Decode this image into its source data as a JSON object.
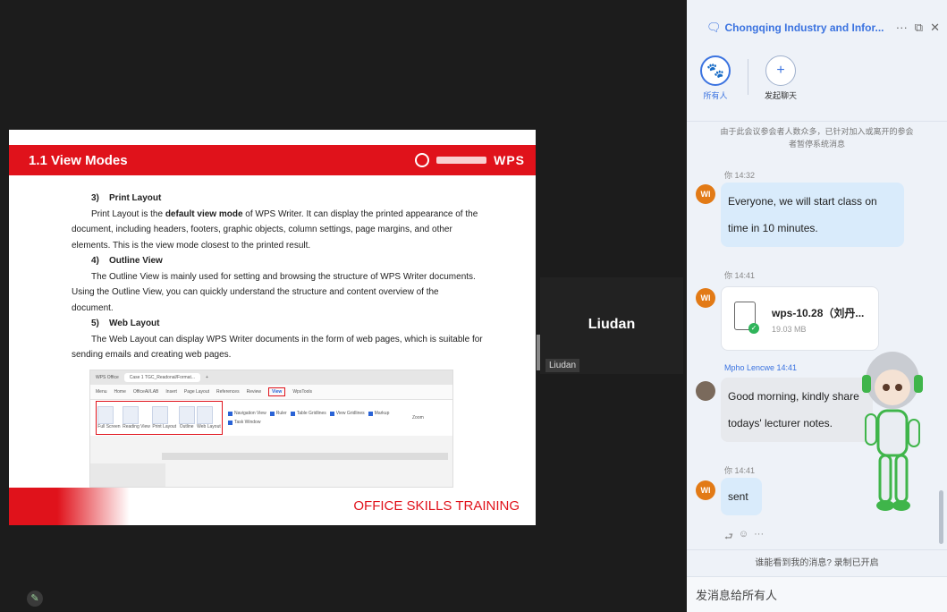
{
  "slide": {
    "title": "1.1 View Modes",
    "brand": "WPS",
    "footer": "OFFICE SKILLS TRAINING",
    "sections": [
      {
        "heading": "3)    Print Layout",
        "text_pre": "Print Layout is the ",
        "text_bold": "default view mode",
        "text_post": " of WPS Writer. It can display the printed appearance of the document, including headers, footers, graphic objects, column settings, page margins, and other elements. This is the view mode closest to the printed result."
      },
      {
        "heading": "4)    Outline View",
        "text": "The Outline View is mainly used for setting and browsing the structure of WPS Writer documents. Using the Outline View, you can quickly understand the structure and content overview of the document."
      },
      {
        "heading": "5)    Web Layout",
        "text": "The Web Layout can display WPS Writer documents in the form of web pages, which is suitable for sending emails and creating web pages."
      }
    ],
    "mini": {
      "app": "WPS Office",
      "doc_tab": "Case 1 TGC_Readonal/Format...",
      "menu": [
        "Menu",
        "Home",
        "OfficeAI/LAB",
        "Insert",
        "Page Layout",
        "References",
        "Review",
        "View",
        "WpsTools"
      ],
      "active_menu": "View",
      "buttons": [
        "Full Screen",
        "Reading View",
        "Print Layout",
        "Outline",
        "Web Layout"
      ],
      "checks": [
        "Navigation View",
        "Ruler",
        "Table Gridlines",
        "View Gridlines",
        "Markup",
        "Task Window"
      ],
      "zoom": "Zoom"
    }
  },
  "tile": {
    "name": "Liudan",
    "label": "Liudan"
  },
  "panel": {
    "group_name": "Chongqing Industry and Infor...",
    "convos": [
      {
        "label": "所有人",
        "active": true
      },
      {
        "label": "发起聊天",
        "active": false
      }
    ],
    "system_note": "由于此会议参会者人数众多，已针对加入或离开的参会者暂停系统消息",
    "messages": [
      {
        "avatar": "WI",
        "meta": "你 14:32",
        "text": "Everyone, we will start class on time in 10 minutes."
      },
      {
        "avatar": "WI",
        "meta": "你 14:41",
        "file_name": "wps-10.28（刘丹...",
        "file_size": "19.03 MB"
      },
      {
        "avatar": "",
        "meta": "Mpho Lencwe 14:41",
        "text": "Good morning, kindly share todays' lecturer notes."
      },
      {
        "avatar": "WI",
        "meta": "你 14:41",
        "text": "sent"
      }
    ],
    "read_note": "谁能看到我的消息? 录制已开启",
    "compose_placeholder": "发消息给所有人"
  },
  "colors": {
    "accent_red": "#e0121b",
    "accent_blue": "#3b73e0",
    "avatar_orange": "#e27a16"
  },
  "icons": [
    "chat-icon",
    "more-icon",
    "popout-icon",
    "close-icon",
    "paw-icon",
    "plus-icon",
    "file-icon",
    "check-icon",
    "reply-icon",
    "emoji-icon",
    "pencil-icon"
  ]
}
